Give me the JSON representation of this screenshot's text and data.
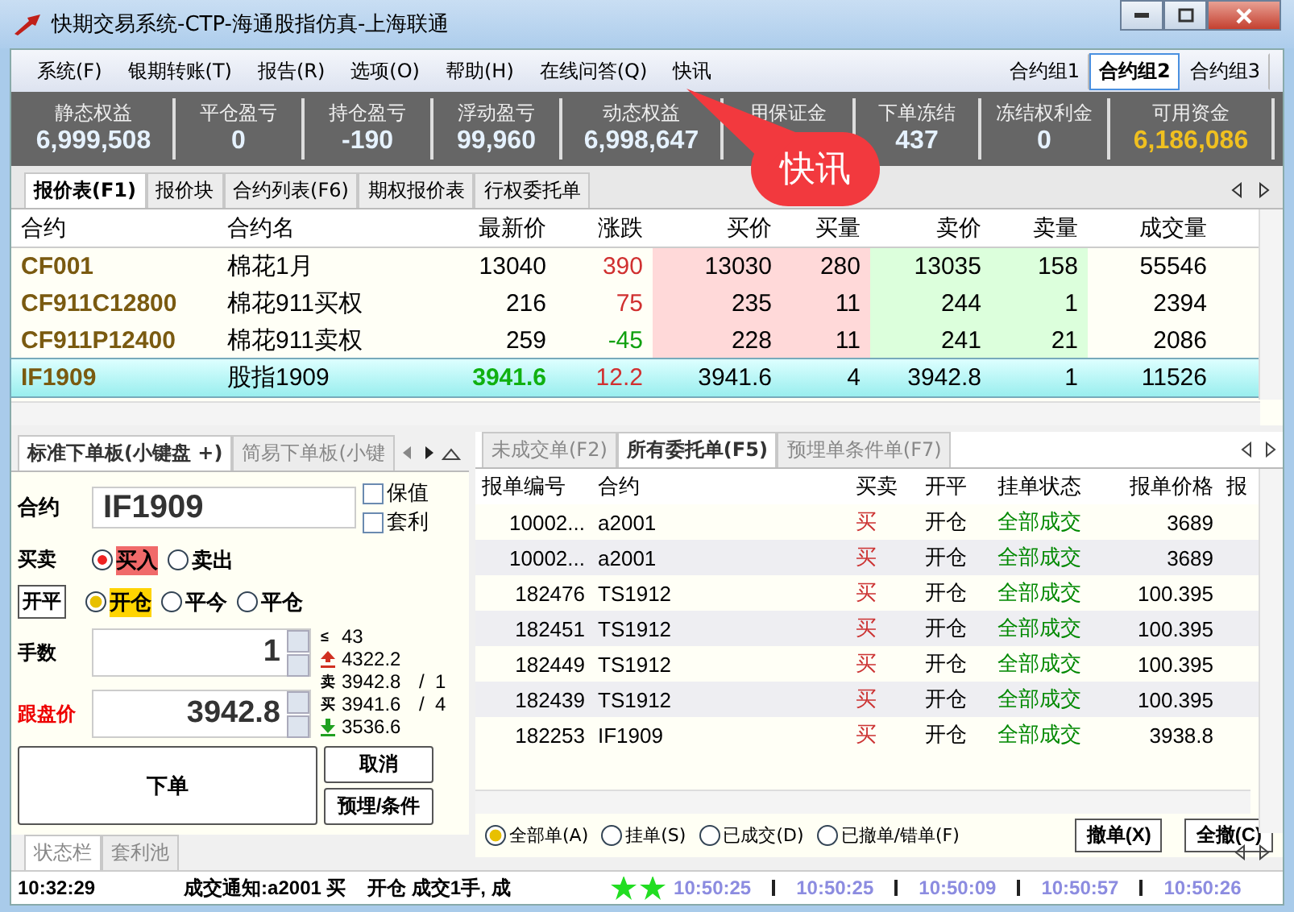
{
  "window": {
    "title": "快期交易系统-CTP-海通股指仿真-上海联通"
  },
  "menu": [
    "系统(F)",
    "银期转账(T)",
    "报告(R)",
    "选项(O)",
    "帮助(H)",
    "在线问答(Q)",
    "快讯"
  ],
  "contract_groups": [
    {
      "label": "合约组1",
      "selected": false
    },
    {
      "label": "合约组2",
      "selected": true
    },
    {
      "label": "合约组3",
      "selected": false
    }
  ],
  "stats": [
    {
      "label": "静态权益",
      "value": "6,999,508",
      "highlight": false
    },
    {
      "label": "平仓盈亏",
      "value": "0",
      "highlight": false
    },
    {
      "label": "持仓盈亏",
      "value": "-190",
      "highlight": false
    },
    {
      "label": "浮动盈亏",
      "value": "99,960",
      "highlight": false
    },
    {
      "label": "动态权益",
      "value": "6,998,647",
      "highlight": false
    },
    {
      "label": "用保证金",
      "highlight": false
    },
    {
      "label": "下单冻结",
      "value": "437",
      "highlight": false
    },
    {
      "label": "冻结权利金",
      "value": "0",
      "highlight": false
    },
    {
      "label": "可用资金",
      "value": "6,186,086",
      "highlight": true
    }
  ],
  "callout": {
    "text": "快讯"
  },
  "quote_tabs": [
    {
      "label": "报价表(F1)",
      "selected": true
    },
    {
      "label": "报价块",
      "selected": false
    },
    {
      "label": "合约列表(F6)",
      "selected": false
    },
    {
      "label": "期权报价表",
      "selected": false
    },
    {
      "label": "行权委托单",
      "selected": false
    }
  ],
  "quote_table": {
    "columns": [
      "合约",
      "合约名",
      "最新价",
      "涨跌",
      "买价",
      "买量",
      "卖价",
      "卖量",
      "成交量"
    ],
    "rows": [
      {
        "cells": [
          "CF001",
          "棉花1月",
          "13040",
          "390",
          "13030",
          "280",
          "13035",
          "158",
          "55546"
        ],
        "selected": false
      },
      {
        "cells": [
          "CF911C12800",
          "棉花911买权",
          "216",
          "75",
          "235",
          "11",
          "244",
          "1",
          "2394"
        ],
        "selected": false
      },
      {
        "cells": [
          "CF911P12400",
          "棉花911卖权",
          "259",
          "-45",
          "228",
          "11",
          "241",
          "21",
          "2086"
        ],
        "selected": false
      },
      {
        "cells": [
          "IF1909",
          "股指1909",
          "3941.6",
          "12.2",
          "3941.6",
          "4",
          "3942.8",
          "1",
          "11526"
        ],
        "selected": true
      }
    ]
  },
  "order_panel_tabs": [
    {
      "label": "标准下单板(小键盘 +)",
      "selected": true
    },
    {
      "label": "简易下单板(小键",
      "selected": false
    }
  ],
  "order_form": {
    "contract_label": "合约",
    "contract": "IF1909",
    "checkboxes": [
      {
        "label": "保值",
        "checked": false
      },
      {
        "label": "套利",
        "checked": false
      }
    ],
    "side_label": "买卖",
    "sides": [
      {
        "label": "买入",
        "selected": true
      },
      {
        "label": "卖出",
        "selected": false
      }
    ],
    "offset_button": "开平",
    "offsets": [
      {
        "label": "开仓",
        "selected": true
      },
      {
        "label": "平今",
        "selected": false
      },
      {
        "label": "平仓",
        "selected": false
      }
    ],
    "qty_label": "手数",
    "qty": "1",
    "price_label": "跟盘价",
    "price": "3942.8",
    "info": [
      {
        "kind": "max",
        "mark": "≤",
        "value": "43"
      },
      {
        "kind": "limit_up",
        "value": "4322.2"
      },
      {
        "kind": "ask",
        "mark": "卖",
        "value": "3942.8",
        "volume": "/  1"
      },
      {
        "kind": "bid",
        "mark": "买",
        "value": "3941.6",
        "volume": "/  4"
      },
      {
        "kind": "limit_down",
        "value": "3536.6"
      }
    ],
    "buttons": [
      "下单",
      "取消",
      "预埋/条件"
    ]
  },
  "order_tabs": [
    {
      "label": "未成交单(F2)",
      "selected": false
    },
    {
      "label": "所有委托单(F5)",
      "selected": true
    },
    {
      "label": "预埋单条件单(F7)",
      "selected": false
    }
  ],
  "order_table": {
    "columns": [
      "报单编号",
      "合约",
      "买卖",
      "开平",
      "挂单状态",
      "报单价格",
      "报"
    ],
    "rows": [
      [
        "10002...",
        "a2001",
        "买",
        "开仓",
        "全部成交",
        "3689"
      ],
      [
        "10002...",
        "a2001",
        "买",
        "开仓",
        "全部成交",
        "3689"
      ],
      [
        "182476",
        "TS1912",
        "买",
        "开仓",
        "全部成交",
        "100.395"
      ],
      [
        "182451",
        "TS1912",
        "买",
        "开仓",
        "全部成交",
        "100.395"
      ],
      [
        "182449",
        "TS1912",
        "买",
        "开仓",
        "全部成交",
        "100.395"
      ],
      [
        "182439",
        "TS1912",
        "买",
        "开仓",
        "全部成交",
        "100.395"
      ],
      [
        "182253",
        "IF1909",
        "买",
        "开仓",
        "全部成交",
        "3938.8"
      ]
    ]
  },
  "order_filters": [
    {
      "label": "全部单(A)",
      "selected": true
    },
    {
      "label": "挂单(S)",
      "selected": false
    },
    {
      "label": "已成交(D)",
      "selected": false
    },
    {
      "label": "已撤单/错单(F)",
      "selected": false
    }
  ],
  "order_buttons": [
    "撤单(X)",
    "全撤(C)"
  ],
  "bottom_tabs": [
    {
      "label": "状态栏",
      "selected": true
    },
    {
      "label": "套利池",
      "selected": false
    }
  ],
  "status_bar": {
    "time": "10:32:29",
    "message": "成交通知:a2001 买    开仓 成交1手, 成",
    "times": [
      "10:50:25",
      "10:50:25",
      "10:50:09",
      "10:50:57",
      "10:50:26"
    ]
  }
}
